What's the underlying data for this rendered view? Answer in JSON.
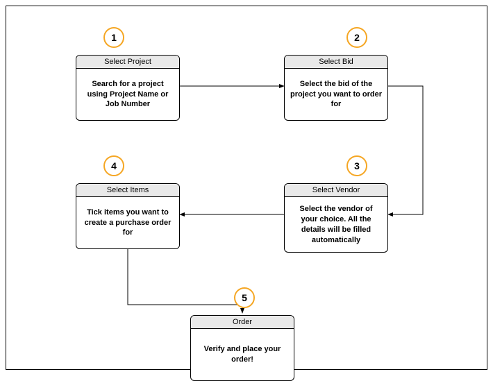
{
  "diagram": {
    "type": "flowchart",
    "steps": [
      {
        "number": "1",
        "title": "Select Project",
        "description": "Search for a project using Project Name or Job Number"
      },
      {
        "number": "2",
        "title": "Select Bid",
        "description": "Select the bid of the project you want to order for"
      },
      {
        "number": "3",
        "title": "Select Vendor",
        "description": "Select the vendor of your choice. All the details will be filled automatically"
      },
      {
        "number": "4",
        "title": "Select Items",
        "description": "Tick items you want to create a purchase order for"
      },
      {
        "number": "5",
        "title": "Order",
        "description": "Verify and place your order!"
      }
    ],
    "connections": [
      {
        "from": 1,
        "to": 2
      },
      {
        "from": 2,
        "to": 3
      },
      {
        "from": 3,
        "to": 4
      },
      {
        "from": 4,
        "to": 5
      }
    ],
    "accent_color": "#f5a623"
  }
}
